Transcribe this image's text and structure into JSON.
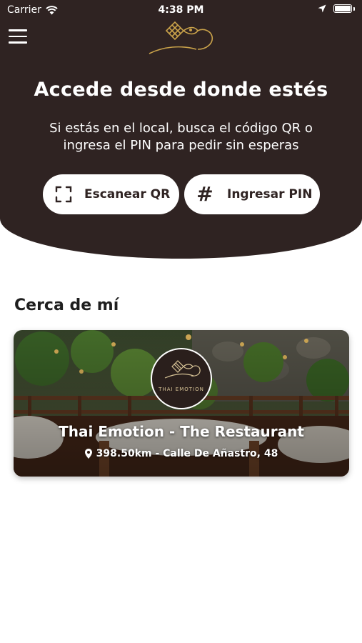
{
  "status_bar": {
    "carrier": "Carrier",
    "time": "4:38 PM"
  },
  "header": {
    "title": "Accede desde donde estés",
    "subtitle": "Si estás en el local, busca el código QR o ingresa el PIN para pedir sin esperas",
    "scan_label": "Escanear QR",
    "pin_label": "Ingresar PIN",
    "pin_icon_glyph": "#"
  },
  "nearby": {
    "section_title": "Cerca de mí",
    "restaurants": [
      {
        "name": "Thai Emotion - The Restaurant",
        "distance_address": "398.50km - Calle De Añastro, 48",
        "logo_text": "THAI EMOTION"
      }
    ]
  },
  "colors": {
    "header_bg": "#2f2322",
    "accent_gold": "#c9a24a",
    "text_dark": "#1e1e1e"
  },
  "icons": [
    "wifi-icon",
    "location-arrow-icon",
    "battery-icon",
    "menu-icon",
    "qr-scan-icon",
    "hash-icon",
    "map-pin-icon"
  ]
}
